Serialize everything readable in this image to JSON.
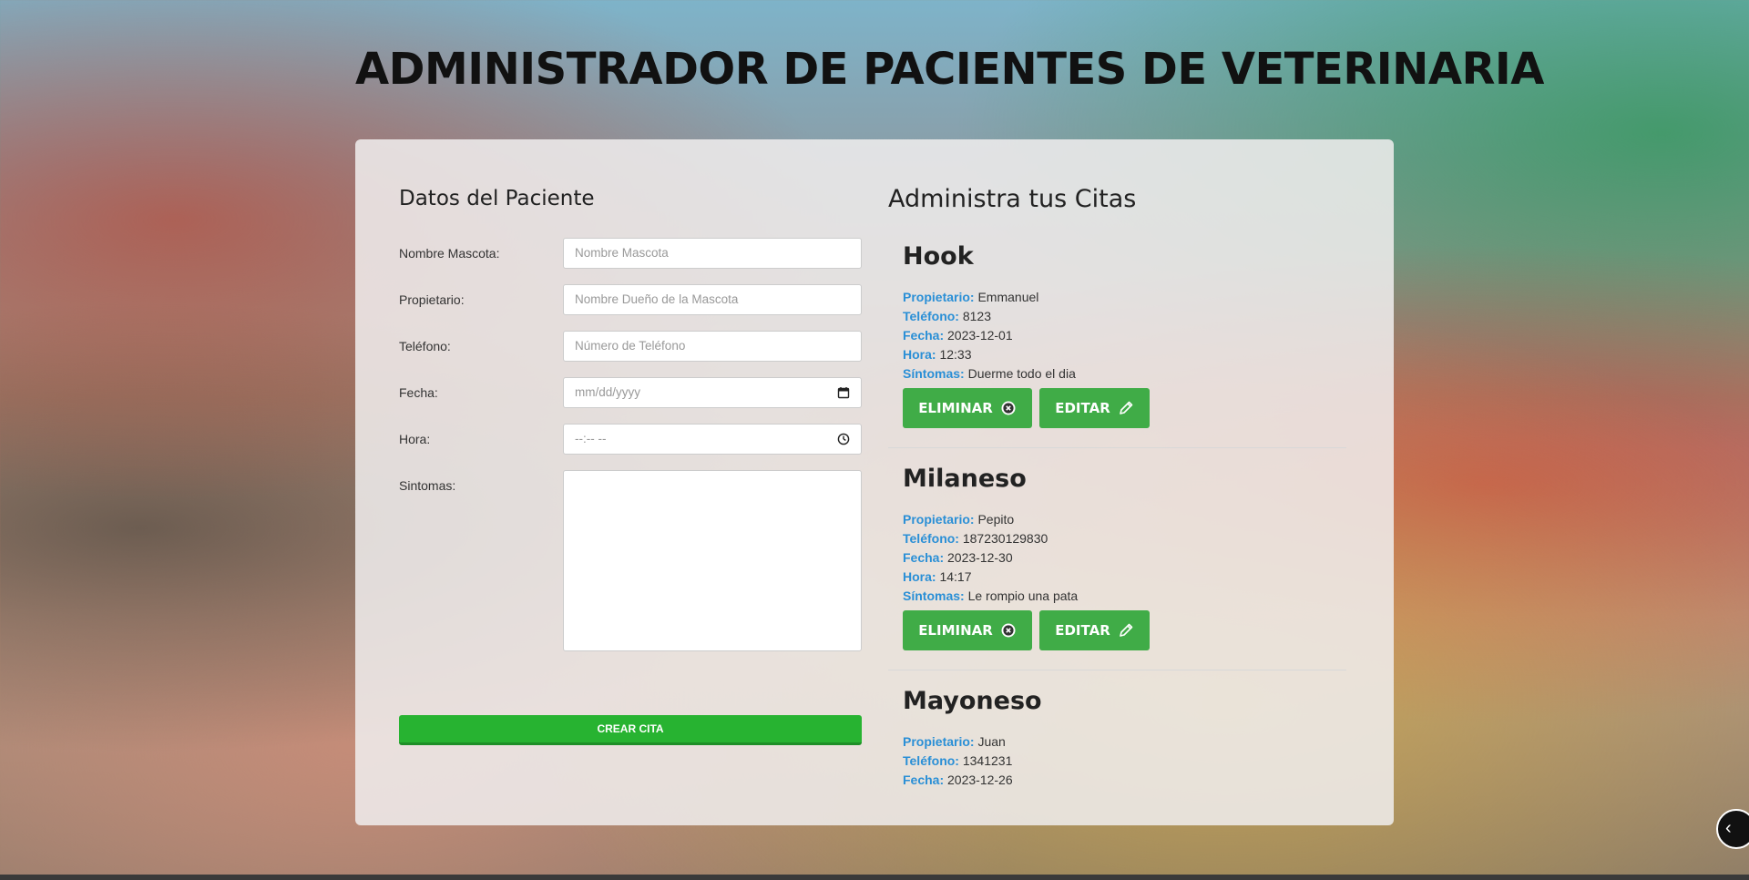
{
  "page": {
    "title": "ADMINISTRADOR DE PACIENTES DE VETERINARIA"
  },
  "form": {
    "title": "Datos del Paciente",
    "fields": [
      {
        "label": "Nombre Mascota:",
        "placeholder": "Nombre Mascota"
      },
      {
        "label": "Propietario:",
        "placeholder": "Nombre Dueño de la Mascota"
      },
      {
        "label": "Teléfono:",
        "placeholder": "Número de Teléfono"
      },
      {
        "label": "Fecha:",
        "placeholder": "mm/dd/yyyy"
      },
      {
        "label": "Hora:",
        "placeholder": "--:-- --"
      },
      {
        "label": "Sintomas:",
        "placeholder": ""
      }
    ],
    "submit_label": "CREAR CITA"
  },
  "appointments": {
    "title": "Administra tus Citas",
    "keys": {
      "owner": "Propietario:",
      "phone": "Teléfono:",
      "date": "Fecha:",
      "time": "Hora:",
      "symptoms": "Síntomas:"
    },
    "delete_label": "ELIMINAR",
    "edit_label": "EDITAR",
    "items": [
      {
        "name": "Hook",
        "owner": "Emmanuel",
        "phone": "8123",
        "date": "2023-12-01",
        "time": "12:33",
        "symptoms": "Duerme todo el dia"
      },
      {
        "name": "Milaneso",
        "owner": "Pepito",
        "phone": "187230129830",
        "date": "2023-12-30",
        "time": "14:17",
        "symptoms": "Le rompio una pata"
      },
      {
        "name": "Mayoneso",
        "owner": "Juan",
        "phone": "1341231",
        "date": "2023-12-26",
        "time": "",
        "symptoms": ""
      }
    ]
  },
  "icons": {
    "delete": "x-circle-icon",
    "edit": "pencil-icon",
    "date": "calendar-icon",
    "time": "clock-icon"
  },
  "colors": {
    "accent_key": "#2a8fd6",
    "button_green": "#40ac47",
    "submit_green": "#27b331"
  }
}
